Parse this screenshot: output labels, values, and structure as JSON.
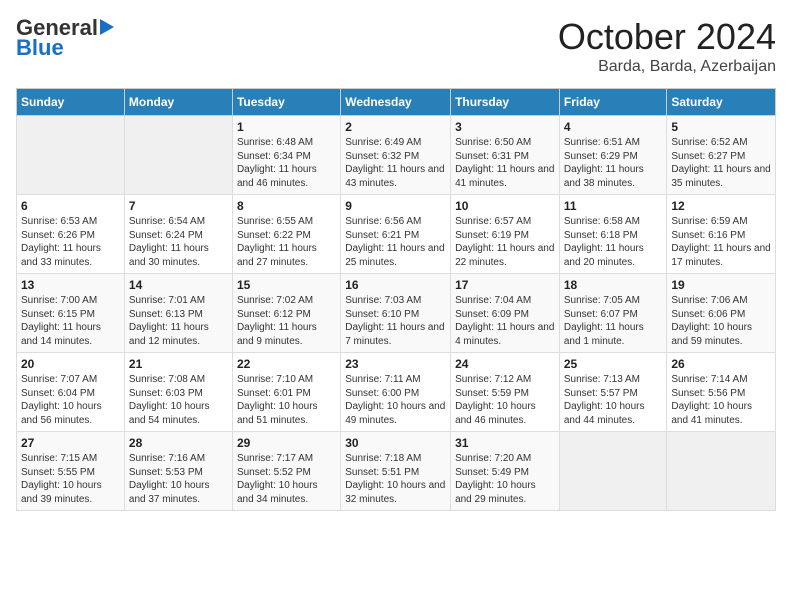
{
  "header": {
    "logo_general": "General",
    "logo_blue": "Blue",
    "title": "October 2024",
    "subtitle": "Barda, Barda, Azerbaijan"
  },
  "columns": [
    "Sunday",
    "Monday",
    "Tuesday",
    "Wednesday",
    "Thursday",
    "Friday",
    "Saturday"
  ],
  "weeks": [
    [
      {
        "day": "",
        "info": ""
      },
      {
        "day": "",
        "info": ""
      },
      {
        "day": "1",
        "info": "Sunrise: 6:48 AM\nSunset: 6:34 PM\nDaylight: 11 hours and 46 minutes."
      },
      {
        "day": "2",
        "info": "Sunrise: 6:49 AM\nSunset: 6:32 PM\nDaylight: 11 hours and 43 minutes."
      },
      {
        "day": "3",
        "info": "Sunrise: 6:50 AM\nSunset: 6:31 PM\nDaylight: 11 hours and 41 minutes."
      },
      {
        "day": "4",
        "info": "Sunrise: 6:51 AM\nSunset: 6:29 PM\nDaylight: 11 hours and 38 minutes."
      },
      {
        "day": "5",
        "info": "Sunrise: 6:52 AM\nSunset: 6:27 PM\nDaylight: 11 hours and 35 minutes."
      }
    ],
    [
      {
        "day": "6",
        "info": "Sunrise: 6:53 AM\nSunset: 6:26 PM\nDaylight: 11 hours and 33 minutes."
      },
      {
        "day": "7",
        "info": "Sunrise: 6:54 AM\nSunset: 6:24 PM\nDaylight: 11 hours and 30 minutes."
      },
      {
        "day": "8",
        "info": "Sunrise: 6:55 AM\nSunset: 6:22 PM\nDaylight: 11 hours and 27 minutes."
      },
      {
        "day": "9",
        "info": "Sunrise: 6:56 AM\nSunset: 6:21 PM\nDaylight: 11 hours and 25 minutes."
      },
      {
        "day": "10",
        "info": "Sunrise: 6:57 AM\nSunset: 6:19 PM\nDaylight: 11 hours and 22 minutes."
      },
      {
        "day": "11",
        "info": "Sunrise: 6:58 AM\nSunset: 6:18 PM\nDaylight: 11 hours and 20 minutes."
      },
      {
        "day": "12",
        "info": "Sunrise: 6:59 AM\nSunset: 6:16 PM\nDaylight: 11 hours and 17 minutes."
      }
    ],
    [
      {
        "day": "13",
        "info": "Sunrise: 7:00 AM\nSunset: 6:15 PM\nDaylight: 11 hours and 14 minutes."
      },
      {
        "day": "14",
        "info": "Sunrise: 7:01 AM\nSunset: 6:13 PM\nDaylight: 11 hours and 12 minutes."
      },
      {
        "day": "15",
        "info": "Sunrise: 7:02 AM\nSunset: 6:12 PM\nDaylight: 11 hours and 9 minutes."
      },
      {
        "day": "16",
        "info": "Sunrise: 7:03 AM\nSunset: 6:10 PM\nDaylight: 11 hours and 7 minutes."
      },
      {
        "day": "17",
        "info": "Sunrise: 7:04 AM\nSunset: 6:09 PM\nDaylight: 11 hours and 4 minutes."
      },
      {
        "day": "18",
        "info": "Sunrise: 7:05 AM\nSunset: 6:07 PM\nDaylight: 11 hours and 1 minute."
      },
      {
        "day": "19",
        "info": "Sunrise: 7:06 AM\nSunset: 6:06 PM\nDaylight: 10 hours and 59 minutes."
      }
    ],
    [
      {
        "day": "20",
        "info": "Sunrise: 7:07 AM\nSunset: 6:04 PM\nDaylight: 10 hours and 56 minutes."
      },
      {
        "day": "21",
        "info": "Sunrise: 7:08 AM\nSunset: 6:03 PM\nDaylight: 10 hours and 54 minutes."
      },
      {
        "day": "22",
        "info": "Sunrise: 7:10 AM\nSunset: 6:01 PM\nDaylight: 10 hours and 51 minutes."
      },
      {
        "day": "23",
        "info": "Sunrise: 7:11 AM\nSunset: 6:00 PM\nDaylight: 10 hours and 49 minutes."
      },
      {
        "day": "24",
        "info": "Sunrise: 7:12 AM\nSunset: 5:59 PM\nDaylight: 10 hours and 46 minutes."
      },
      {
        "day": "25",
        "info": "Sunrise: 7:13 AM\nSunset: 5:57 PM\nDaylight: 10 hours and 44 minutes."
      },
      {
        "day": "26",
        "info": "Sunrise: 7:14 AM\nSunset: 5:56 PM\nDaylight: 10 hours and 41 minutes."
      }
    ],
    [
      {
        "day": "27",
        "info": "Sunrise: 7:15 AM\nSunset: 5:55 PM\nDaylight: 10 hours and 39 minutes."
      },
      {
        "day": "28",
        "info": "Sunrise: 7:16 AM\nSunset: 5:53 PM\nDaylight: 10 hours and 37 minutes."
      },
      {
        "day": "29",
        "info": "Sunrise: 7:17 AM\nSunset: 5:52 PM\nDaylight: 10 hours and 34 minutes."
      },
      {
        "day": "30",
        "info": "Sunrise: 7:18 AM\nSunset: 5:51 PM\nDaylight: 10 hours and 32 minutes."
      },
      {
        "day": "31",
        "info": "Sunrise: 7:20 AM\nSunset: 5:49 PM\nDaylight: 10 hours and 29 minutes."
      },
      {
        "day": "",
        "info": ""
      },
      {
        "day": "",
        "info": ""
      }
    ]
  ]
}
